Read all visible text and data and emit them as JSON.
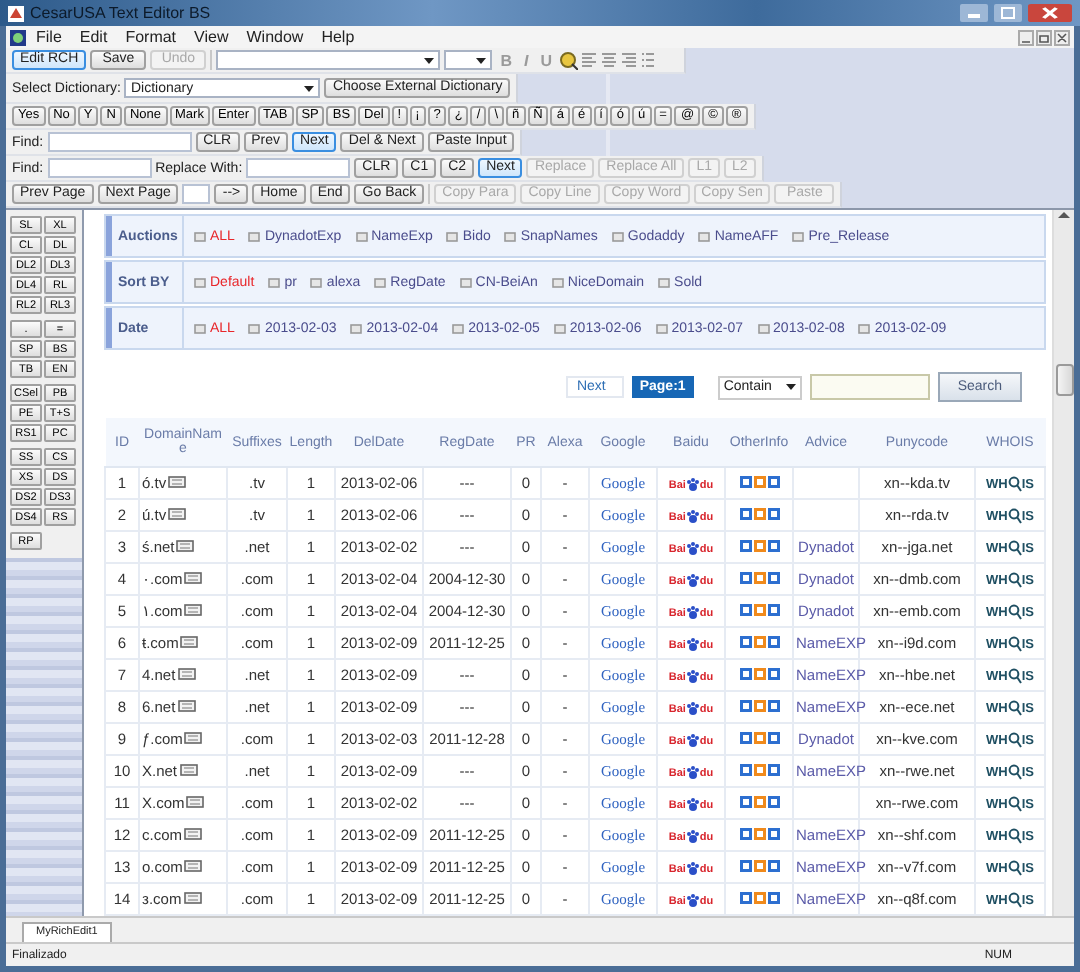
{
  "window": {
    "title": "CesarUSA Text Editor BS"
  },
  "menu": [
    "File",
    "Edit",
    "Format",
    "View",
    "Window",
    "Help"
  ],
  "toolbar": {
    "buttons": [
      {
        "label": "Edit RCH",
        "highlighted": true,
        "disabled": false
      },
      {
        "label": "Save",
        "highlighted": false,
        "disabled": false
      },
      {
        "label": "Undo",
        "highlighted": false,
        "disabled": true
      }
    ],
    "format_buttons": [
      "B",
      "I",
      "U"
    ]
  },
  "dictionary": {
    "label": "Select Dictionary:",
    "value": "Dictionary",
    "button": "Choose External Dictionary"
  },
  "char_buttons": [
    "Yes",
    "No",
    "Y",
    "N",
    "None",
    "Mark",
    "Enter",
    "TAB",
    "SP",
    "BS",
    "Del",
    "!",
    "¡",
    "?",
    "¿",
    "/",
    "\\",
    "ñ",
    "Ñ",
    "á",
    "é",
    "í",
    "ó",
    "ú",
    "=",
    "@",
    "©",
    "®"
  ],
  "find_bar": {
    "label": "Find:",
    "buttons": [
      {
        "label": "CLR",
        "highlighted": false
      },
      {
        "label": "Prev",
        "highlighted": false
      },
      {
        "label": "Next",
        "highlighted": true
      },
      {
        "label": "Del & Next",
        "highlighted": false
      },
      {
        "label": "Paste Input",
        "highlighted": false
      }
    ]
  },
  "replace_bar": {
    "find_label": "Find:",
    "replace_label": "Replace With:",
    "buttons": [
      {
        "label": "CLR",
        "highlighted": false,
        "disabled": false
      },
      {
        "label": "C1",
        "highlighted": false,
        "disabled": false
      },
      {
        "label": "C2",
        "highlighted": false,
        "disabled": false
      },
      {
        "label": "Next",
        "highlighted": true,
        "disabled": false
      },
      {
        "label": "Replace",
        "highlighted": false,
        "disabled": true
      },
      {
        "label": "Replace All",
        "highlighted": false,
        "disabled": true
      },
      {
        "label": "L1",
        "highlighted": false,
        "disabled": true
      },
      {
        "label": "L2",
        "highlighted": false,
        "disabled": true
      }
    ]
  },
  "page_bar": {
    "left_buttons": [
      "Prev Page",
      "Next Page"
    ],
    "right_buttons": [
      "-->",
      "Home",
      "End",
      "Go Back"
    ],
    "copy_buttons": [
      {
        "label": "Copy Para",
        "disabled": true
      },
      {
        "label": "Copy Line",
        "disabled": true
      },
      {
        "label": "Copy Word",
        "disabled": true
      },
      {
        "label": "Copy Sen",
        "disabled": true
      },
      {
        "label": "Paste",
        "disabled": true
      }
    ]
  },
  "sidebar": {
    "groups": [
      [
        "SL",
        "XL",
        "CL",
        "DL",
        "DL2",
        "DL3",
        "DL4",
        "RL",
        "RL2",
        "RL3"
      ],
      [
        ".",
        "=",
        "SP",
        "BS",
        "TB",
        "EN"
      ],
      [
        "CSel",
        "PB",
        "PE",
        "T+S",
        "RS1",
        "PC"
      ],
      [
        "SS",
        "CS",
        "XS",
        "DS",
        "DS2",
        "DS3",
        "DS4",
        "RS"
      ],
      [
        "RP"
      ]
    ]
  },
  "filters": [
    {
      "label": "Auctions",
      "options": [
        {
          "label": "ALL",
          "selected": true
        },
        {
          "label": "DynadotExp",
          "selected": false
        },
        {
          "label": "NameExp",
          "selected": false
        },
        {
          "label": "Bido",
          "selected": false
        },
        {
          "label": "SnapNames",
          "selected": false
        },
        {
          "label": "Godaddy",
          "selected": false
        },
        {
          "label": "NameAFF",
          "selected": false
        },
        {
          "label": "Pre_Release",
          "selected": false
        }
      ]
    },
    {
      "label": "Sort BY",
      "options": [
        {
          "label": "Default",
          "selected": true
        },
        {
          "label": "pr",
          "selected": false
        },
        {
          "label": "alexa",
          "selected": false
        },
        {
          "label": "RegDate",
          "selected": false
        },
        {
          "label": "CN-BeiAn",
          "selected": false
        },
        {
          "label": "NiceDomain",
          "selected": false
        },
        {
          "label": "Sold",
          "selected": false
        }
      ]
    },
    {
      "label": "Date",
      "options": [
        {
          "label": "ALL",
          "selected": true
        },
        {
          "label": "2013-02-03",
          "selected": false
        },
        {
          "label": "2013-02-04",
          "selected": false
        },
        {
          "label": "2013-02-05",
          "selected": false
        },
        {
          "label": "2013-02-06",
          "selected": false
        },
        {
          "label": "2013-02-07",
          "selected": false
        },
        {
          "label": "2013-02-08",
          "selected": false
        },
        {
          "label": "2013-02-09",
          "selected": false
        }
      ]
    }
  ],
  "pager": {
    "next": "Next",
    "page": "Page:1",
    "match": "Contain",
    "search": "Search"
  },
  "table": {
    "columns": [
      "ID",
      "DomainName",
      "Suffixes",
      "Length",
      "DelDate",
      "RegDate",
      "PR",
      "Alexa",
      "Google",
      "Baidu",
      "OtherInfo",
      "Advice",
      "Punycode",
      "WHOIS"
    ],
    "rows": [
      {
        "id": "1",
        "domain": "ó.tv",
        "suffix": ".tv",
        "length": "1",
        "del_date": "2013-02-06",
        "reg_date": "---",
        "pr": "0",
        "alexa": "-",
        "google": "Google",
        "baidu": [
          "Bai",
          "du"
        ],
        "punycode": "xn--kda.tv",
        "whois": [
          "WH",
          "IS"
        ]
      },
      {
        "id": "2",
        "domain": "ú.tv",
        "suffix": ".tv",
        "length": "1",
        "del_date": "2013-02-06",
        "reg_date": "---",
        "pr": "0",
        "alexa": "-",
        "google": "Google",
        "baidu": [
          "Bai",
          "du"
        ],
        "punycode": "xn--rda.tv",
        "whois": [
          "WH",
          "IS"
        ]
      },
      {
        "id": "3",
        "domain": "ś.net",
        "suffix": ".net",
        "length": "1",
        "del_date": "2013-02-02",
        "reg_date": "---",
        "pr": "0",
        "alexa": "-",
        "google": "Google",
        "baidu": [
          "Bai",
          "du"
        ],
        "advice": "Dynadot",
        "punycode": "xn--jga.net",
        "whois": [
          "WH",
          "IS"
        ]
      },
      {
        "id": "4",
        "domain": "٠.com",
        "suffix": ".com",
        "length": "1",
        "del_date": "2013-02-04",
        "reg_date": "2004-12-30",
        "pr": "0",
        "alexa": "-",
        "google": "Google",
        "baidu": [
          "Bai",
          "du"
        ],
        "advice": "Dynadot",
        "punycode": "xn--dmb.com",
        "whois": [
          "WH",
          "IS"
        ]
      },
      {
        "id": "5",
        "domain": "١.com",
        "suffix": ".com",
        "length": "1",
        "del_date": "2013-02-04",
        "reg_date": "2004-12-30",
        "pr": "0",
        "alexa": "-",
        "google": "Google",
        "baidu": [
          "Bai",
          "du"
        ],
        "advice": "Dynadot",
        "punycode": "xn--emb.com",
        "whois": [
          "WH",
          "IS"
        ]
      },
      {
        "id": "6",
        "domain": "ŧ.com",
        "suffix": ".com",
        "length": "1",
        "del_date": "2013-02-09",
        "reg_date": "2011-12-25",
        "pr": "0",
        "alexa": "-",
        "google": "Google",
        "baidu": [
          "Bai",
          "du"
        ],
        "advice": "NameEXP",
        "punycode": "xn--i9d.com",
        "whois": [
          "WH",
          "IS"
        ]
      },
      {
        "id": "7",
        "domain": "4.net",
        "suffix": ".net",
        "length": "1",
        "del_date": "2013-02-09",
        "reg_date": "---",
        "pr": "0",
        "alexa": "-",
        "google": "Google",
        "baidu": [
          "Bai",
          "du"
        ],
        "advice": "NameEXP",
        "punycode": "xn--hbe.net",
        "whois": [
          "WH",
          "IS"
        ]
      },
      {
        "id": "8",
        "domain": "6.net",
        "suffix": ".net",
        "length": "1",
        "del_date": "2013-02-09",
        "reg_date": "---",
        "pr": "0",
        "alexa": "-",
        "google": "Google",
        "baidu": [
          "Bai",
          "du"
        ],
        "advice": "NameEXP",
        "punycode": "xn--ece.net",
        "whois": [
          "WH",
          "IS"
        ]
      },
      {
        "id": "9",
        "domain": "ƒ.com",
        "suffix": ".com",
        "length": "1",
        "del_date": "2013-02-03",
        "reg_date": "2011-12-28",
        "pr": "0",
        "alexa": "-",
        "google": "Google",
        "baidu": [
          "Bai",
          "du"
        ],
        "advice": "Dynadot",
        "punycode": "xn--kve.com",
        "whois": [
          "WH",
          "IS"
        ]
      },
      {
        "id": "10",
        "domain": "X.net",
        "suffix": ".net",
        "length": "1",
        "del_date": "2013-02-09",
        "reg_date": "---",
        "pr": "0",
        "alexa": "-",
        "google": "Google",
        "baidu": [
          "Bai",
          "du"
        ],
        "advice": "NameEXP",
        "punycode": "xn--rwe.net",
        "whois": [
          "WH",
          "IS"
        ]
      },
      {
        "id": "11",
        "domain": "X.com",
        "suffix": ".com",
        "length": "1",
        "del_date": "2013-02-02",
        "reg_date": "---",
        "pr": "0",
        "alexa": "-",
        "google": "Google",
        "baidu": [
          "Bai",
          "du"
        ],
        "punycode": "xn--rwe.com",
        "whois": [
          "WH",
          "IS"
        ]
      },
      {
        "id": "12",
        "domain": "c.com",
        "suffix": ".com",
        "length": "1",
        "del_date": "2013-02-09",
        "reg_date": "2011-12-25",
        "pr": "0",
        "alexa": "-",
        "google": "Google",
        "baidu": [
          "Bai",
          "du"
        ],
        "advice": "NameEXP",
        "punycode": "xn--shf.com",
        "whois": [
          "WH",
          "IS"
        ]
      },
      {
        "id": "13",
        "domain": "o.com",
        "suffix": ".com",
        "length": "1",
        "del_date": "2013-02-09",
        "reg_date": "2011-12-25",
        "pr": "0",
        "alexa": "-",
        "google": "Google",
        "baidu": [
          "Bai",
          "du"
        ],
        "advice": "NameEXP",
        "punycode": "xn--v7f.com",
        "whois": [
          "WH",
          "IS"
        ]
      },
      {
        "id": "14",
        "domain": "з.com",
        "suffix": ".com",
        "length": "1",
        "del_date": "2013-02-09",
        "reg_date": "2011-12-25",
        "pr": "0",
        "alexa": "-",
        "google": "Google",
        "baidu": [
          "Bai",
          "du"
        ],
        "advice": "NameEXP",
        "punycode": "xn--q8f.com",
        "whois": [
          "WH",
          "IS"
        ]
      }
    ]
  },
  "tabs": [
    {
      "label": "MyRichEdit1",
      "selected": true
    }
  ],
  "status_bar": {
    "text": "Finalizado",
    "num": "NUM"
  }
}
